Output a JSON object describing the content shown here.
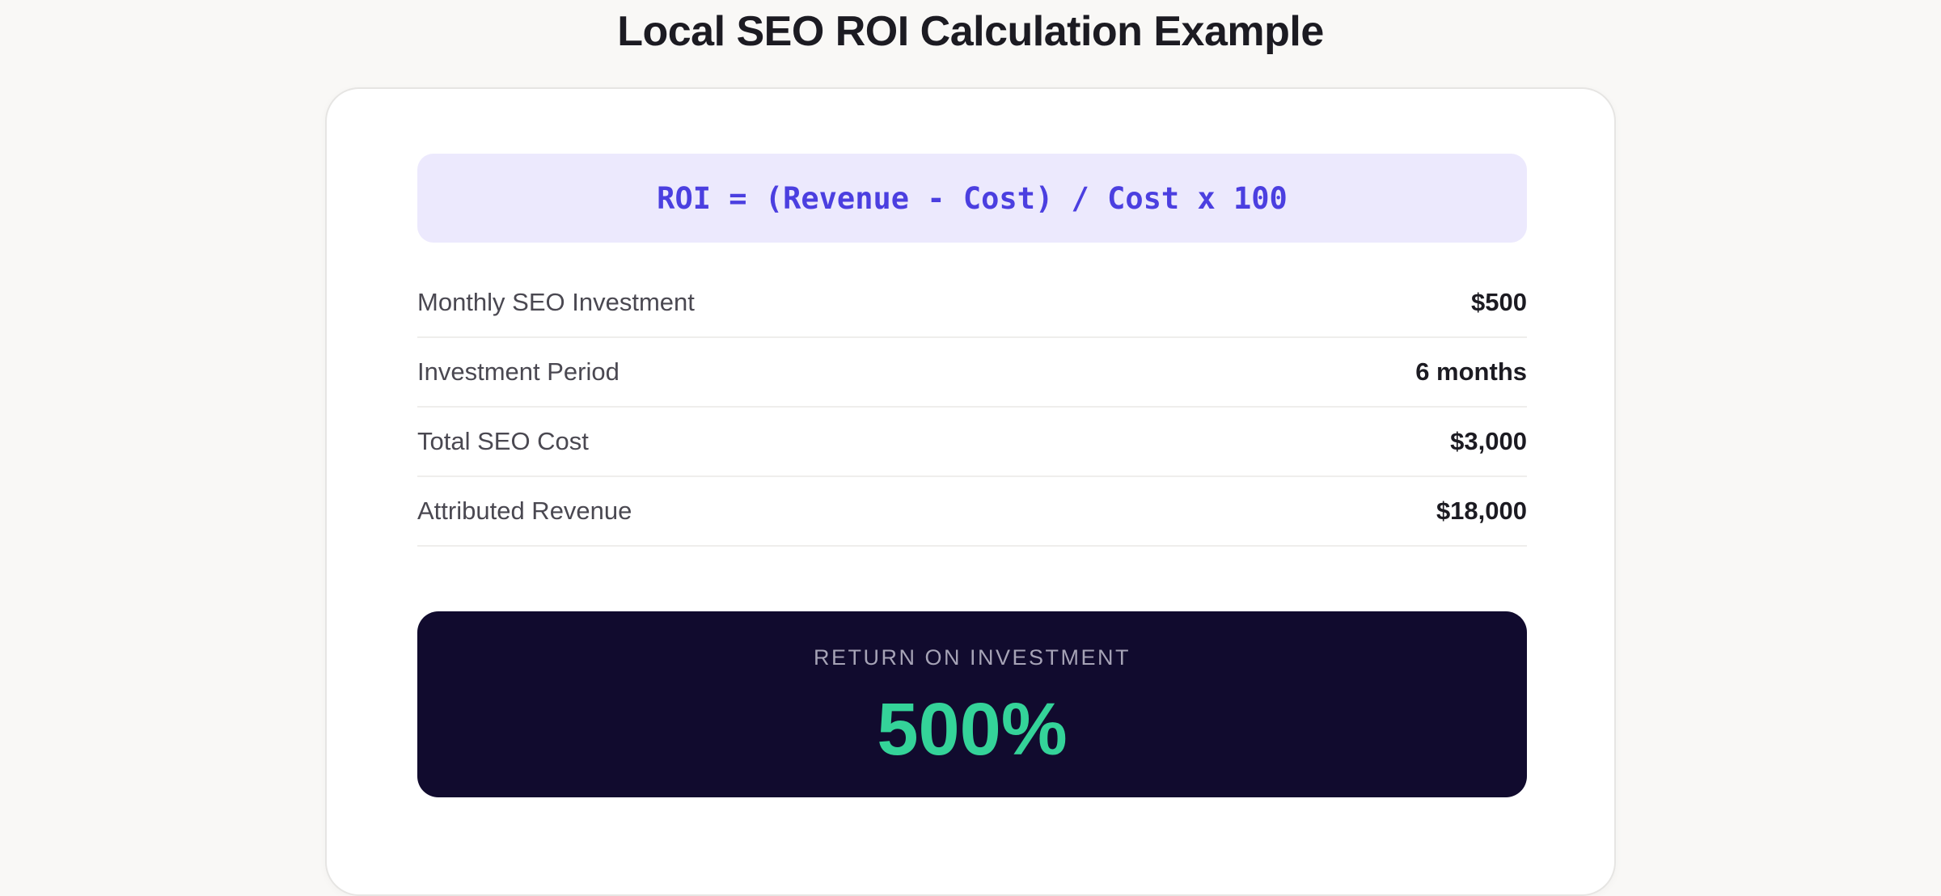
{
  "page": {
    "title": "Local SEO ROI Calculation Example"
  },
  "formula": {
    "text": "ROI = (Revenue - Cost) / Cost x 100",
    "background_color": "#ece9fd",
    "text_color": "#4b3fe0"
  },
  "rows": [
    {
      "label": "Monthly SEO Investment",
      "value": "$500"
    },
    {
      "label": "Investment Period",
      "value": "6 months"
    },
    {
      "label": "Total SEO Cost",
      "value": "$3,000"
    },
    {
      "label": "Attributed Revenue",
      "value": "$18,000"
    }
  ],
  "result": {
    "label": "RETURN ON INVESTMENT",
    "value": "500%",
    "background_color": "#110b2e",
    "value_color": "#34d399"
  }
}
